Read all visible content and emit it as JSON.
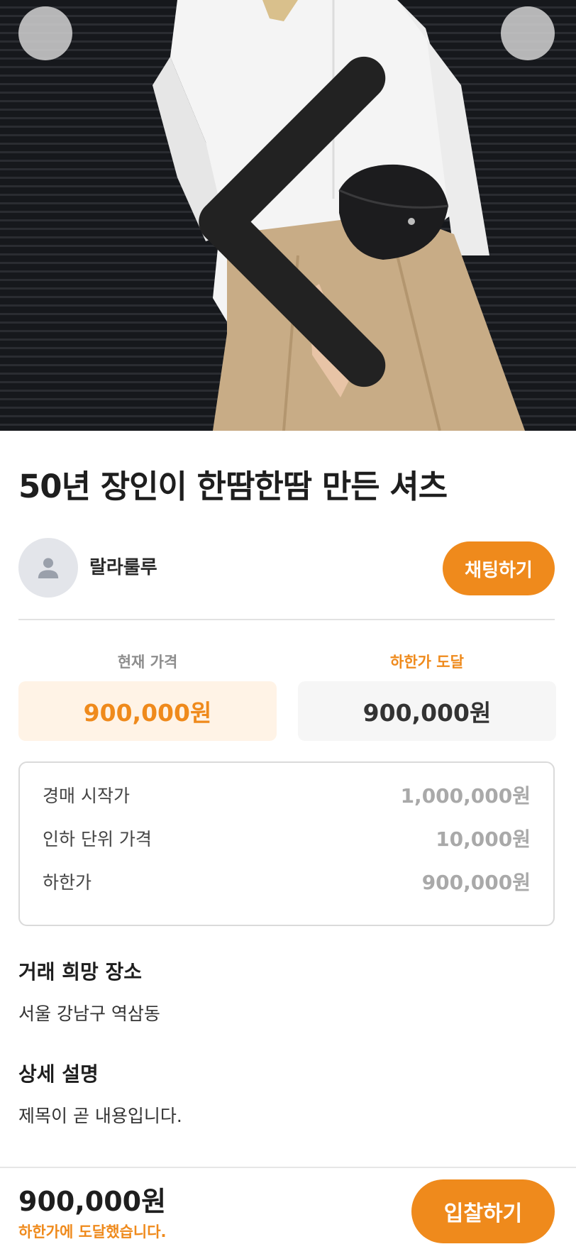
{
  "product": {
    "title": "50년 장인이 한땀한땀 만든 셔츠",
    "image_icon": "product-photo"
  },
  "header": {
    "back_icon": "chevron-left-icon",
    "like_icon": "heart-icon"
  },
  "seller": {
    "name": "랄라룰루",
    "avatar_icon": "person-icon",
    "chat_label": "채팅하기"
  },
  "prices": {
    "current_label": "현재 가격",
    "current_value": "900,000원",
    "floor_label": "하한가 도달",
    "floor_value": "900,000원"
  },
  "auction_info": [
    {
      "key": "경매 시작가",
      "value": "1,000,000원"
    },
    {
      "key": "인하 단위 가격",
      "value": "10,000원"
    },
    {
      "key": "하한가",
      "value": "900,000원"
    }
  ],
  "location": {
    "title": "거래 희망 장소",
    "value": "서울 강남구 역삼동"
  },
  "description": {
    "title": "상세 설명",
    "value": "제목이 곧 내용입니다."
  },
  "bottom_bar": {
    "price": "900,000원",
    "note": "하한가에 도달했습니다.",
    "bid_label": "입찰하기"
  },
  "colors": {
    "accent": "#ef8a1c",
    "accent_light": "#fff3e6"
  }
}
